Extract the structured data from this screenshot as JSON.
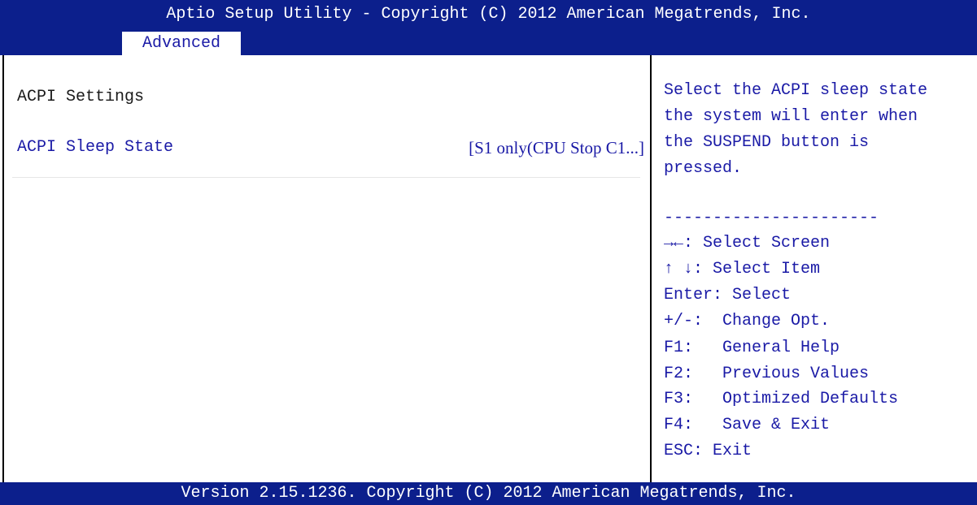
{
  "header": {
    "title": "Aptio Setup Utility - Copyright (C) 2012 American Megatrends, Inc."
  },
  "tabs": [
    {
      "label": "Advanced",
      "active": true
    }
  ],
  "main": {
    "section_title": "ACPI Settings",
    "options": [
      {
        "label": "ACPI Sleep State",
        "value": "[S1 only(CPU Stop C1...]"
      }
    ]
  },
  "help": {
    "description": [
      "Select the ACPI sleep state",
      "the system will enter when",
      "the SUSPEND button is",
      "pressed."
    ],
    "separator": "----------------------",
    "keys": [
      "→←: Select Screen",
      "↑ ↓: Select Item",
      "Enter: Select",
      "+/-:  Change Opt.",
      "F1:   General Help",
      "F2:   Previous Values",
      "F3:   Optimized Defaults",
      "F4:   Save & Exit",
      "ESC: Exit"
    ]
  },
  "footer": {
    "text": "Version 2.15.1236. Copyright (C) 2012 American Megatrends, Inc."
  },
  "colors": {
    "bar_background": "#0c1f8c",
    "bar_text": "#ffffff",
    "body_background": "#ffffff",
    "item_text": "#1a1aa6",
    "section_text": "#1a1a1a"
  }
}
